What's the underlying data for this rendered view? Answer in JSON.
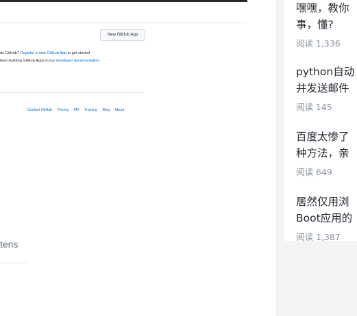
{
  "github": {
    "new_app_button": "New GitHub App",
    "line1_prefix": "ds GitHub? ",
    "line1_link": "Register a new GitHub App",
    "line1_suffix": " to get started",
    "line2_prefix": "bout building GitHub Apps in our ",
    "line2_link": "developer documentation",
    "line2_suffix": ".",
    "footer_links": [
      "Contact GitHub",
      "Pricing",
      "API",
      "Training",
      "Blog",
      "About"
    ]
  },
  "left_tab": {
    "label": "tens"
  },
  "articles": [
    {
      "title_line1": "嘿嘿，教你",
      "title_line2": "事，懂?",
      "meta": "阅读 1,336"
    },
    {
      "title_line1": "python自动",
      "title_line2": "并发送邮件",
      "meta": "阅读 145"
    },
    {
      "title_line1": "百度太惨了",
      "title_line2": "种方法，亲",
      "meta": "阅读 649"
    },
    {
      "title_line1": "居然仅用浏",
      "title_line2": "Boot应用的",
      "meta": "阅读 1,387"
    }
  ]
}
